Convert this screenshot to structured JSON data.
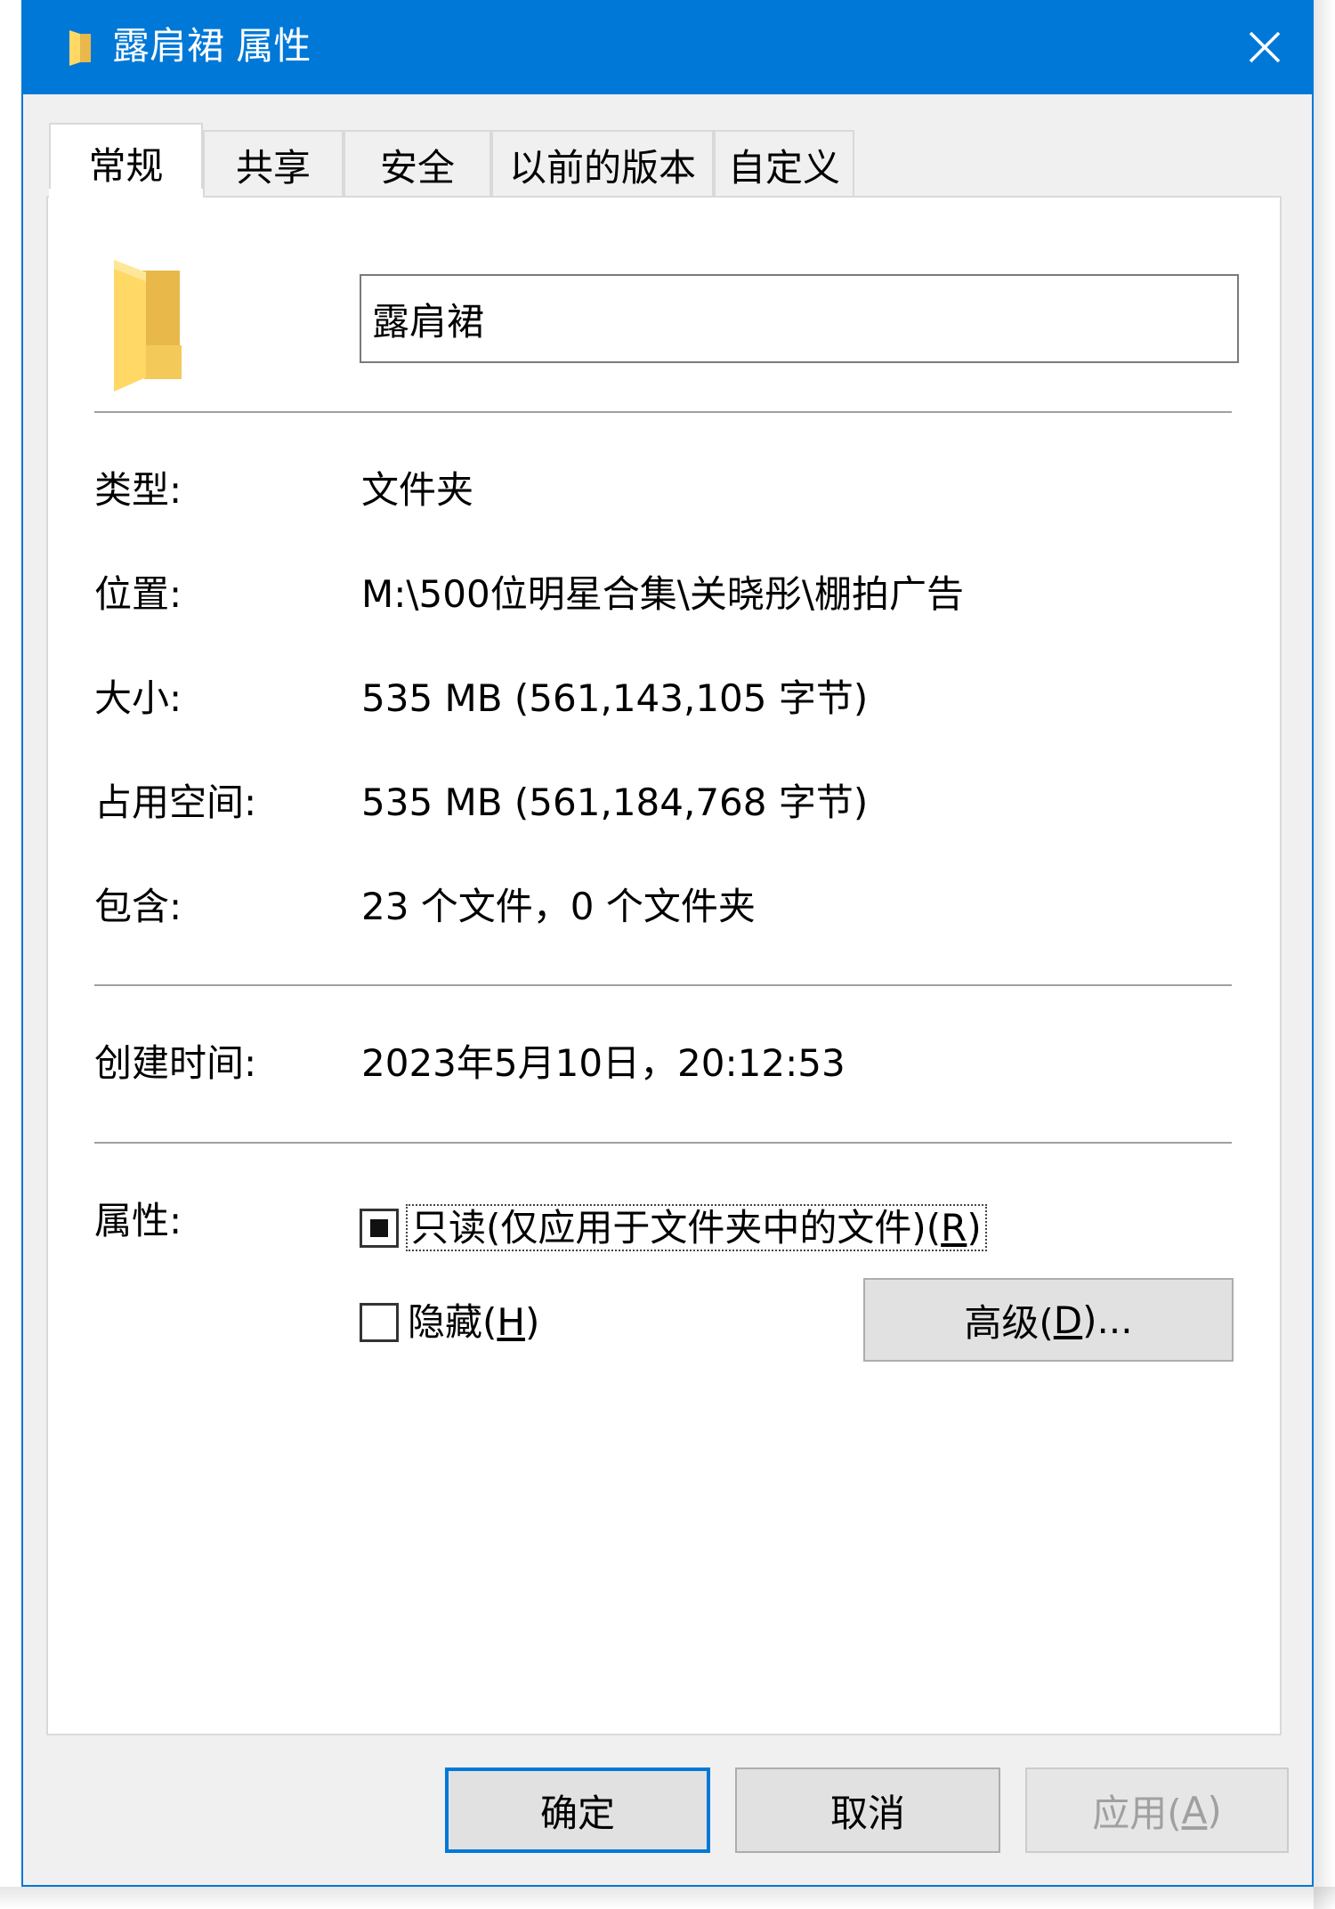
{
  "window": {
    "title": "露肩裙 属性",
    "close_icon": "close-icon",
    "accent_color": "#0078d7"
  },
  "tabs": [
    {
      "label": "常规",
      "active": true
    },
    {
      "label": "共享",
      "active": false
    },
    {
      "label": "安全",
      "active": false
    },
    {
      "label": "以前的版本",
      "active": false
    },
    {
      "label": "自定义",
      "active": false
    }
  ],
  "general": {
    "folder_icon": "folder-icon",
    "name_value": "露肩裙",
    "type_label": "类型:",
    "type_value": "文件夹",
    "location_label": "位置:",
    "location_value": "M:\\500位明星合集\\关晓彤\\棚拍广告",
    "size_label": "大小:",
    "size_value": "535 MB (561,143,105 字节)",
    "disk_size_label": "占用空间:",
    "disk_size_value": "535 MB (561,184,768 字节)",
    "contains_label": "包含:",
    "contains_value": "23 个文件，0 个文件夹",
    "created_label": "创建时间:",
    "created_value": "2023年5月10日，20:12:53",
    "attributes_label": "属性:",
    "readonly": {
      "text": "只读(仅应用于文件夹中的文件)(",
      "key": "R",
      "end": ")",
      "state": "indeterminate"
    },
    "hidden": {
      "text": "隐藏(",
      "key": "H",
      "end": ")",
      "checked": false
    },
    "advanced": {
      "text": "高级(",
      "key": "D",
      "end": ")..."
    }
  },
  "footer": {
    "ok": "确定",
    "cancel": "取消",
    "apply": {
      "text": "应用(",
      "key": "A",
      "end": ")",
      "disabled": true
    }
  }
}
